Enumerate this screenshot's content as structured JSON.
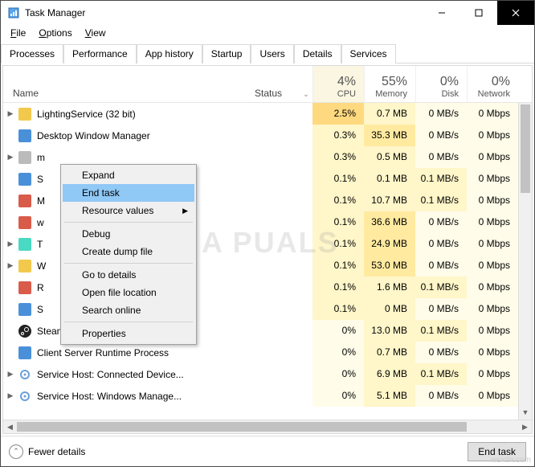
{
  "window": {
    "title": "Task Manager"
  },
  "menubar": {
    "file": "File",
    "options": "Options",
    "view": "View"
  },
  "tabs": [
    "Processes",
    "Performance",
    "App history",
    "Startup",
    "Users",
    "Details",
    "Services"
  ],
  "active_tab": 0,
  "columns": {
    "name": "Name",
    "status": "Status",
    "cpu": {
      "pct": "4%",
      "label": "CPU"
    },
    "memory": {
      "pct": "55%",
      "label": "Memory"
    },
    "disk": {
      "pct": "0%",
      "label": "Disk"
    },
    "network": {
      "pct": "0%",
      "label": "Network"
    }
  },
  "processes": [
    {
      "exp": true,
      "icon": "yellow-icon",
      "name": "LightingService (32 bit)",
      "cpu": "2.5%",
      "mem": "0.7 MB",
      "disk": "0 MB/s",
      "net": "0 Mbps"
    },
    {
      "exp": false,
      "icon": "blue-icon",
      "name": "Desktop Window Manager",
      "cpu": "0.3%",
      "mem": "35.3 MB",
      "disk": "0 MB/s",
      "net": "0 Mbps"
    },
    {
      "exp": true,
      "icon": "gray-icon",
      "name": "m",
      "cpu": "0.3%",
      "mem": "0.5 MB",
      "disk": "0 MB/s",
      "net": "0 Mbps"
    },
    {
      "exp": false,
      "icon": "blue-icon",
      "name": "S",
      "cpu": "0.1%",
      "mem": "0.1 MB",
      "disk": "0.1 MB/s",
      "net": "0 Mbps"
    },
    {
      "exp": false,
      "icon": "red-icon",
      "name": "M",
      "cpu": "0.1%",
      "mem": "10.7 MB",
      "disk": "0.1 MB/s",
      "net": "0 Mbps"
    },
    {
      "exp": false,
      "icon": "red-icon",
      "name": "w",
      "cpu": "0.1%",
      "mem": "36.6 MB",
      "disk": "0 MB/s",
      "net": "0 Mbps"
    },
    {
      "exp": true,
      "icon": "teal-icon",
      "name": "T",
      "cpu": "0.1%",
      "mem": "24.9 MB",
      "disk": "0 MB/s",
      "net": "0 Mbps"
    },
    {
      "exp": true,
      "icon": "yellow-icon",
      "name": "W",
      "cpu": "0.1%",
      "mem": "53.0 MB",
      "disk": "0 MB/s",
      "net": "0 Mbps"
    },
    {
      "exp": false,
      "icon": "red-icon",
      "name": "R",
      "cpu": "0.1%",
      "mem": "1.6 MB",
      "disk": "0.1 MB/s",
      "net": "0 Mbps"
    },
    {
      "exp": false,
      "icon": "blue-icon",
      "name": "S",
      "cpu": "0.1%",
      "mem": "0 MB",
      "disk": "0 MB/s",
      "net": "0 Mbps"
    },
    {
      "exp": false,
      "icon": "steam-icon",
      "name": "Steam Client Bootstrapper (32 bit)",
      "cpu": "0%",
      "mem": "13.0 MB",
      "disk": "0.1 MB/s",
      "net": "0 Mbps"
    },
    {
      "exp": false,
      "icon": "blue-icon",
      "name": "Client Server Runtime Process",
      "cpu": "0%",
      "mem": "0.7 MB",
      "disk": "0 MB/s",
      "net": "0 Mbps"
    },
    {
      "exp": true,
      "icon": "gear-icon",
      "name": "Service Host: Connected Device...",
      "cpu": "0%",
      "mem": "6.9 MB",
      "disk": "0.1 MB/s",
      "net": "0 Mbps"
    },
    {
      "exp": true,
      "icon": "gear-icon",
      "name": "Service Host: Windows Manage...",
      "cpu": "0%",
      "mem": "5.1 MB",
      "disk": "0 MB/s",
      "net": "0 Mbps"
    }
  ],
  "heat": {
    "cpu": [
      3,
      1,
      1,
      1,
      1,
      1,
      1,
      1,
      1,
      1,
      0,
      0,
      0,
      0
    ],
    "mem": [
      1,
      2,
      1,
      1,
      1,
      2,
      2,
      2,
      1,
      1,
      1,
      1,
      1,
      1
    ],
    "disk": [
      0,
      0,
      0,
      1,
      1,
      0,
      0,
      0,
      1,
      0,
      1,
      0,
      1,
      0
    ],
    "net": [
      0,
      0,
      0,
      0,
      0,
      0,
      0,
      0,
      0,
      0,
      0,
      0,
      0,
      0
    ]
  },
  "context_menu": {
    "items": [
      "Expand",
      "End task",
      "Resource values",
      "Debug",
      "Create dump file",
      "Go to details",
      "Open file location",
      "Search online",
      "Properties"
    ],
    "highlighted_index": 1,
    "submenu_index": 2
  },
  "footer": {
    "fewer_details": "Fewer details",
    "end_task": "End task"
  },
  "watermark": "A   PUALS",
  "bottom_watermark": "wsxdn.com"
}
